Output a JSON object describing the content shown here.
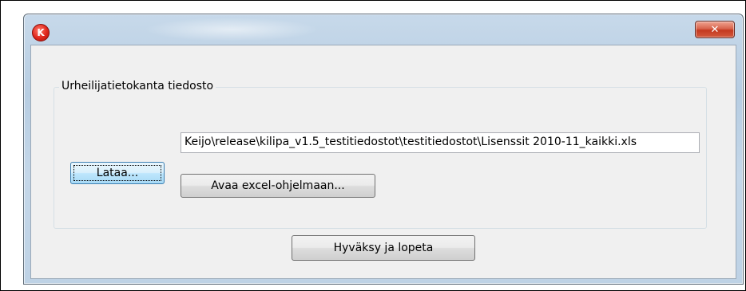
{
  "window": {
    "app_icon_glyph": "K",
    "close_glyph": "✕"
  },
  "group": {
    "title": "Urheilijatietokanta tiedosto"
  },
  "load_button": {
    "label": "Lataa..."
  },
  "file_path": {
    "value": "Keijo\\release\\kilipa_v1.5_testitiedostot\\testitiedostot\\Lisenssit 2010-11_kaikki.xls"
  },
  "open_excel_button": {
    "label": "Avaa excel-ohjelmaan..."
  },
  "accept_button": {
    "label": "Hyväksy ja lopeta"
  },
  "colors": {
    "title_bar": "#c4d7e9",
    "close_button": "#c4391f",
    "app_icon": "#e0261c",
    "client_bg": "#f0f0f0"
  },
  "icons": [
    "app-logo-icon",
    "close-icon"
  ]
}
